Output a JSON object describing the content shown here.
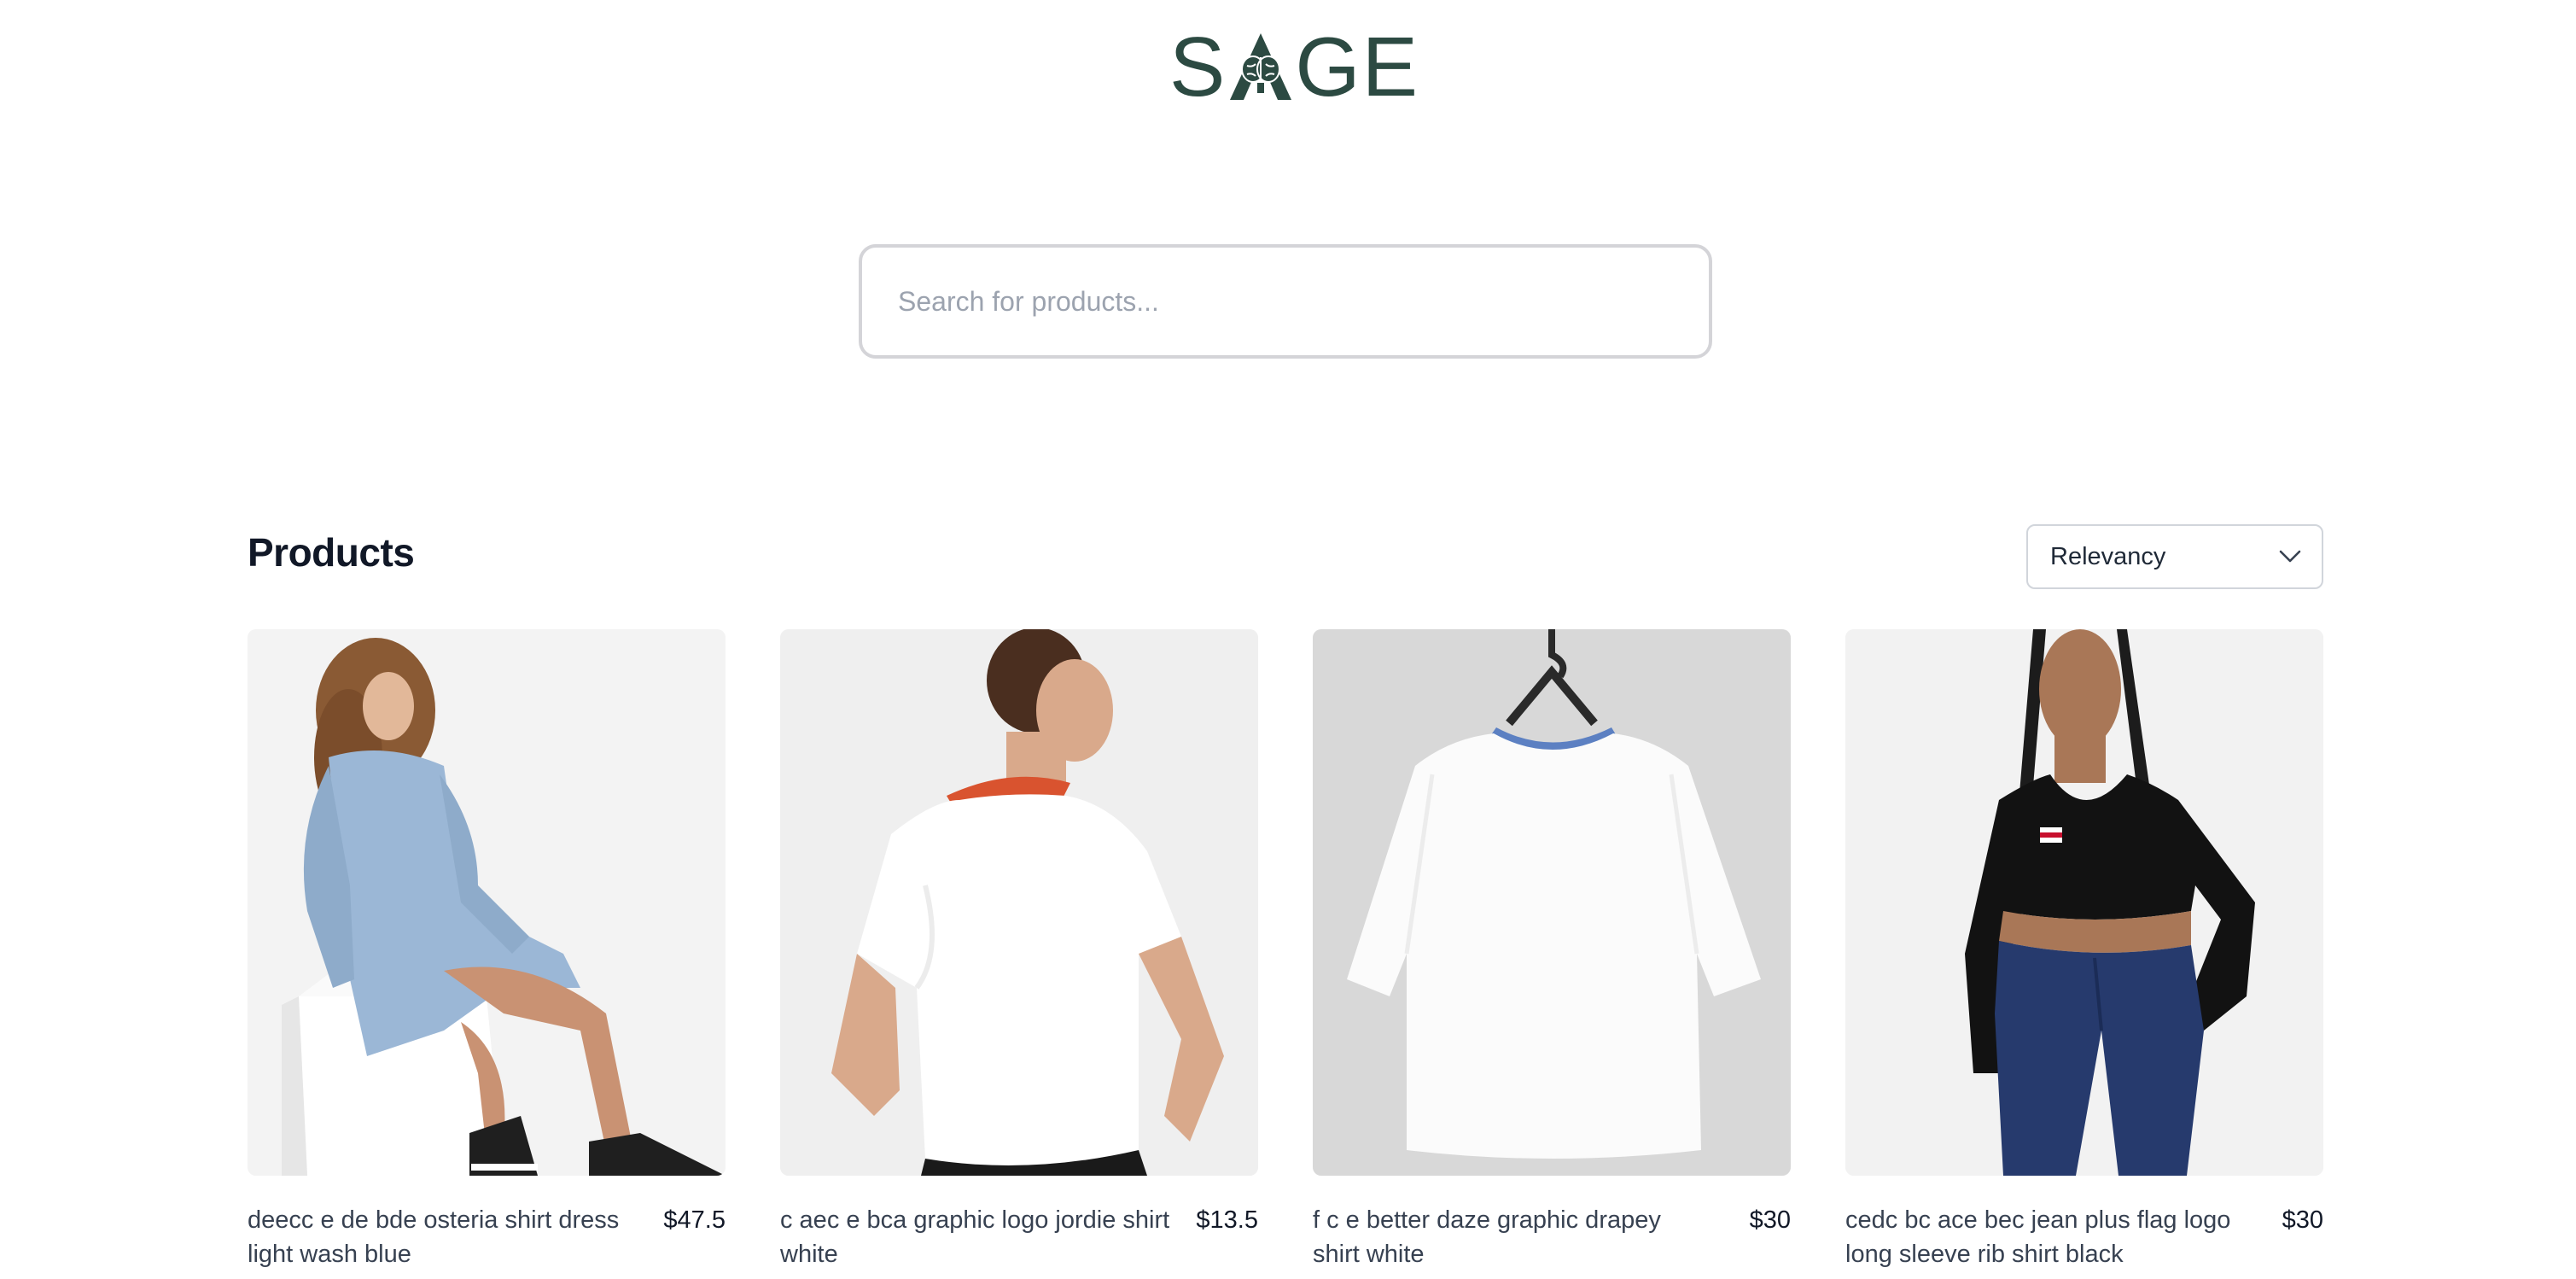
{
  "brand": {
    "logo_text_left": "S",
    "logo_text_right": "GE",
    "logo_color": "#2c4a42"
  },
  "search": {
    "placeholder": "Search for products...",
    "value": ""
  },
  "products_section": {
    "title": "Products",
    "sort": {
      "selected": "Relevancy",
      "icon": "chevron-down-icon"
    }
  },
  "products": [
    {
      "name": "deecc e de bde osteria shirt dress light wash blue",
      "price": "$47.5",
      "image": "model seated in light wash denim shirt dress"
    },
    {
      "name": "c aec e bca graphic logo jordie shirt white",
      "price": "$13.5",
      "image": "model back view in white t-shirt with orange neck trim"
    },
    {
      "name": "f c e better daze graphic drapey shirt white",
      "price": "$30",
      "image": "white t-shirt with blue neck trim on hanger"
    },
    {
      "name": "cedc bc ace bec jean plus flag logo long sleeve rib shirt black",
      "price": "$30",
      "image": "model in black long sleeve crop top and dark blue jeans"
    }
  ],
  "colors": {
    "accent": "#2c4a42",
    "border": "#d4d4d8",
    "text_primary": "#111827",
    "text_secondary": "#374151",
    "placeholder": "#9ca3af"
  }
}
